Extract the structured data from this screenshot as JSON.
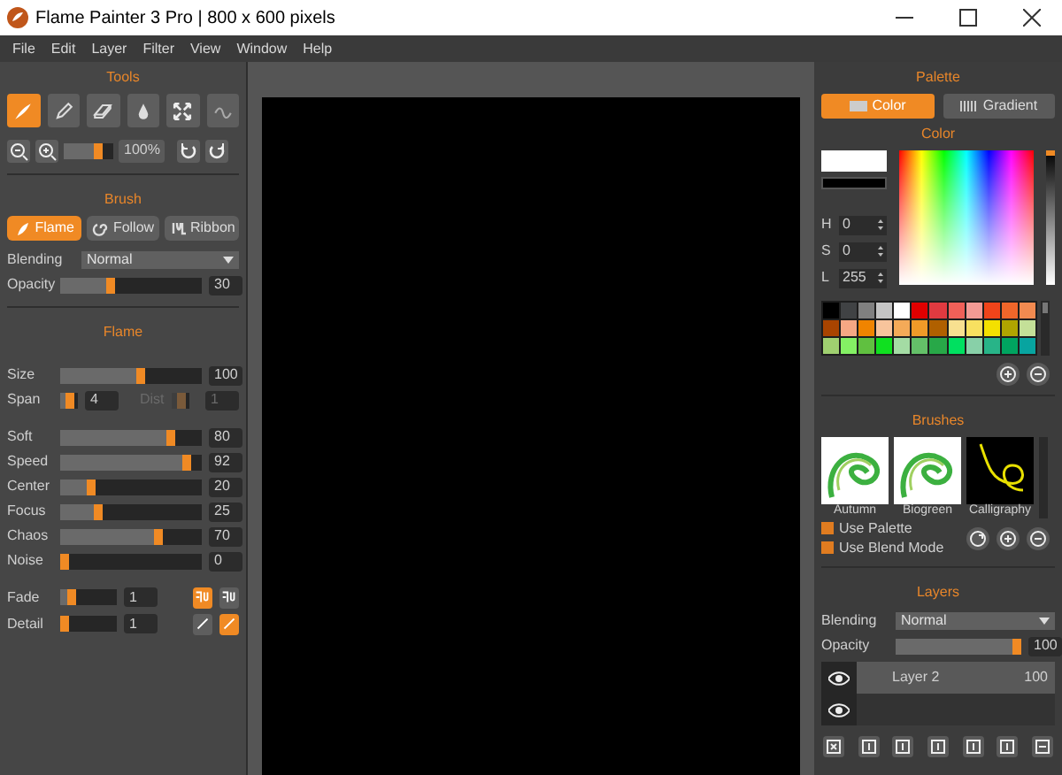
{
  "window": {
    "title": "Flame Painter 3 Pro | 800 x 600 pixels"
  },
  "menu": [
    "File",
    "Edit",
    "Layer",
    "Filter",
    "View",
    "Window",
    "Help"
  ],
  "tools_panel": {
    "title": "Tools",
    "tools": [
      {
        "kind": "flame",
        "selected": true
      },
      {
        "kind": "pencil",
        "selected": false
      },
      {
        "kind": "eraser",
        "selected": false
      },
      {
        "kind": "drop",
        "selected": false
      },
      {
        "kind": "transform",
        "selected": false
      },
      {
        "kind": "wave",
        "selected": false
      }
    ],
    "zoom": {
      "level": 0.72,
      "reading": "100%"
    }
  },
  "brush_panel": {
    "title": "Brush",
    "modes": [
      {
        "kind": "flame",
        "label": "Flame",
        "selected": true
      },
      {
        "kind": "spiral",
        "label": "Follow",
        "selected": false
      },
      {
        "kind": "ribbon",
        "label": "Ribbon",
        "selected": false
      }
    ],
    "blending": {
      "label": "Blending",
      "value": "Normal"
    },
    "opacity": {
      "label": "Opacity",
      "level": 0.35,
      "reading": "30"
    }
  },
  "flame_panel": {
    "title": "Flame",
    "size": {
      "label": "Size",
      "level": 0.57,
      "reading": "100"
    },
    "span": {
      "label": "Span",
      "level": 0.5,
      "reading": "4"
    },
    "dist": {
      "label": "Dist",
      "level": 0.5,
      "reading": "1",
      "disabled": true
    },
    "params": [
      {
        "label": "Soft",
        "level": 0.8,
        "reading": "80"
      },
      {
        "label": "Speed",
        "level": 0.92,
        "reading": "92"
      },
      {
        "label": "Center",
        "level": 0.2,
        "reading": "20"
      },
      {
        "label": "Focus",
        "level": 0.25,
        "reading": "25"
      },
      {
        "label": "Chaos",
        "level": 0.7,
        "reading": "70"
      },
      {
        "label": "Noise",
        "level": 0.0,
        "reading": "0"
      }
    ],
    "fade": {
      "label": "Fade",
      "level": 0.15,
      "reading": "1",
      "options": [
        {
          "selected": true
        },
        {
          "selected": false
        }
      ]
    },
    "detail": {
      "label": "Detail",
      "level": 0.0,
      "reading": "1",
      "options": [
        {
          "selected": false
        },
        {
          "selected": true
        }
      ]
    }
  },
  "palette_panel": {
    "title": "Palette",
    "tabs": [
      {
        "kind": "color",
        "label": "Color",
        "selected": true
      },
      {
        "kind": "gradient",
        "label": "Gradient",
        "selected": false
      }
    ],
    "color_title": "Color",
    "lightness": {
      "level": 1.0
    },
    "hsl": [
      {
        "label": "H",
        "value": "0"
      },
      {
        "label": "S",
        "value": "0"
      },
      {
        "label": "L",
        "value": "255"
      }
    ],
    "swatches": [
      {
        "color": "#000000"
      },
      {
        "color": "#404244"
      },
      {
        "color": "#808080"
      },
      {
        "color": "#c4c4c4"
      },
      {
        "color": "#ffffff"
      },
      {
        "color": "#e00000"
      },
      {
        "color": "#e03a40"
      },
      {
        "color": "#f06058"
      },
      {
        "color": "#f39a94"
      },
      {
        "color": "#f0441a"
      },
      {
        "color": "#f0662a"
      },
      {
        "color": "#f28a50"
      },
      {
        "color": "#a84400"
      },
      {
        "color": "#f6a884"
      },
      {
        "color": "#f08400"
      },
      {
        "color": "#f8c49c"
      },
      {
        "color": "#f4aa58"
      },
      {
        "color": "#f09a28"
      },
      {
        "color": "#b06000"
      },
      {
        "color": "#f8e090"
      },
      {
        "color": "#f8e060"
      },
      {
        "color": "#f4e000"
      },
      {
        "color": "#b0a400"
      },
      {
        "color": "#c4e098"
      },
      {
        "color": "#a0d070"
      },
      {
        "color": "#84f064"
      },
      {
        "color": "#60c040"
      },
      {
        "color": "#10e020"
      },
      {
        "color": "#a4dca4"
      },
      {
        "color": "#64c068"
      },
      {
        "color": "#28a848"
      },
      {
        "color": "#00e060"
      },
      {
        "color": "#88d0a8"
      },
      {
        "color": "#28b488"
      },
      {
        "color": "#00a460"
      },
      {
        "color": "#08a4a0"
      }
    ]
  },
  "brushes_panel": {
    "title": "Brushes",
    "presets": [
      {
        "kind": "light",
        "name": "Autumn",
        "selected": false
      },
      {
        "kind": "light",
        "name": "Biogreen",
        "selected": false
      },
      {
        "kind": "dark",
        "name": "Calligraphy",
        "selected": false
      }
    ],
    "options": [
      {
        "label": "Use Palette",
        "checked": true
      },
      {
        "label": "Use Blend Mode",
        "checked": true
      }
    ]
  },
  "layers_panel": {
    "title": "Layers",
    "blending": {
      "label": "Blending",
      "value": "Normal"
    },
    "opacity": {
      "label": "Opacity",
      "level": 1.0,
      "reading": "100"
    },
    "layers": [
      {
        "name": "Layer 2",
        "opacity": "100",
        "visible": true,
        "selected": true
      },
      {
        "visible": true,
        "selected": false
      }
    ]
  }
}
